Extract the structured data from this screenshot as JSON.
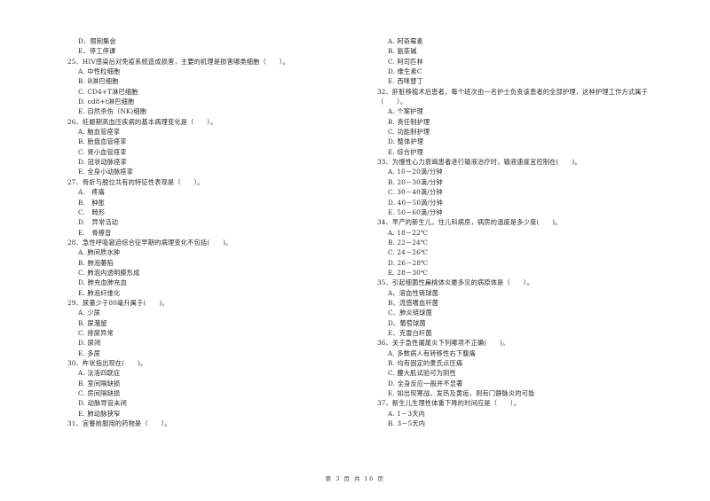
{
  "left_column": [
    {
      "type": "option",
      "text": "D、限制集会"
    },
    {
      "type": "option",
      "text": "E、停工停课"
    },
    {
      "type": "stem",
      "text": "25、HIV感染后对免疫系统造成损害，主要的机理是损害哪类细胞（　　）。"
    },
    {
      "type": "option",
      "text": "A. 中性粒细胞"
    },
    {
      "type": "option",
      "text": "B. B淋巴细胞"
    },
    {
      "type": "option",
      "text": "C. CD4+T淋巴细胞"
    },
    {
      "type": "option",
      "text": "D. cd8+t淋巴细胞"
    },
    {
      "type": "option",
      "text": "E. 自然杀伤（NK)细胞"
    },
    {
      "type": "stem",
      "text": "26、妊娠期高血压疾病的基本病理变化是（　　）。"
    },
    {
      "type": "option",
      "text": "A. 脑血管痉挛"
    },
    {
      "type": "option",
      "text": "B. 胎盘血管痉挛"
    },
    {
      "type": "option",
      "text": "C. 肾小血管痉挛"
    },
    {
      "type": "option",
      "text": "D. 冠状动脉痉挛"
    },
    {
      "type": "option",
      "text": "E. 全身小动脉痉挛"
    },
    {
      "type": "stem",
      "text": "27、骨折与脱位共有的特征性表现是（　　）。"
    },
    {
      "type": "option",
      "text": "A.　疼痛"
    },
    {
      "type": "option",
      "text": "B.　肿胀"
    },
    {
      "type": "option",
      "text": "C.　畸形"
    },
    {
      "type": "option",
      "text": "D.　异常活动"
    },
    {
      "type": "option",
      "text": "E.　骨擦音"
    },
    {
      "type": "stem",
      "text": "28、急性呼吸窘迫综合征早期的病理变化不包括(　　)。"
    },
    {
      "type": "option",
      "text": "A. 肺间质水肿"
    },
    {
      "type": "option",
      "text": "B. 肺泡萎陷"
    },
    {
      "type": "option",
      "text": "C. 肺泡内透明膜形成"
    },
    {
      "type": "option",
      "text": "D. 肺充血肺充血"
    },
    {
      "type": "option",
      "text": "E. 肺泡纤维化"
    },
    {
      "type": "stem",
      "text": "29、尿量少于80毫升属于(　　)。"
    },
    {
      "type": "option",
      "text": "A. 少尿"
    },
    {
      "type": "option",
      "text": "B. 尿潴留"
    },
    {
      "type": "option",
      "text": "C. 排尿异常"
    },
    {
      "type": "option",
      "text": "D. 尿闭"
    },
    {
      "type": "option",
      "text": "E. 多尿"
    },
    {
      "type": "stem",
      "text": "30、杵状指出现在(　　)。"
    },
    {
      "type": "option",
      "text": "A. 法洛四联症"
    },
    {
      "type": "option",
      "text": "B. 室间隔缺损"
    },
    {
      "type": "option",
      "text": "C. 房间隔缺损"
    },
    {
      "type": "option",
      "text": "D. 动脉导管未闭"
    },
    {
      "type": "option",
      "text": "E. 肺动脉狭窄"
    },
    {
      "type": "stem",
      "text": "31、宜餐前服用的药物是（　　）。"
    }
  ],
  "right_column": [
    {
      "type": "option",
      "text": "A. 阿奇霉素"
    },
    {
      "type": "option",
      "text": "B. 氨茶碱"
    },
    {
      "type": "option",
      "text": "C. 阿司匹林"
    },
    {
      "type": "option",
      "text": "D. 维生素C"
    },
    {
      "type": "option",
      "text": "E. 西咪替丁"
    },
    {
      "type": "stem",
      "text": "32、肝脏移植术后患者，每个班次由一名护士负责该患者的全部护理，这种护理工作方式属于"
    },
    {
      "type": "stem",
      "text": "（　　）。"
    },
    {
      "type": "option",
      "text": "A. 个案护理"
    },
    {
      "type": "option",
      "text": "B. 责任制护理"
    },
    {
      "type": "option",
      "text": "C. 功能制护理"
    },
    {
      "type": "option",
      "text": "D. 整体护理"
    },
    {
      "type": "option",
      "text": "E. 综合护理"
    },
    {
      "type": "stem",
      "text": "33、为慢性心力衰竭患者进行输液治疗时，输液速度宜控制在(　　)。"
    },
    {
      "type": "option",
      "text": "A. 10－20滴/分钟"
    },
    {
      "type": "option",
      "text": "B. 20－30滴/分钟"
    },
    {
      "type": "option",
      "text": "C. 30－40滴/分钟"
    },
    {
      "type": "option",
      "text": "D. 40－50滴/分钟"
    },
    {
      "type": "option",
      "text": "E. 50－60滴/分钟"
    },
    {
      "type": "stem",
      "text": "34、早产的新生儿，住儿科病房，病房的温度是多少度(　　)。"
    },
    {
      "type": "option",
      "text": "A. 18－22℃"
    },
    {
      "type": "option",
      "text": "B. 22－24℃"
    },
    {
      "type": "option",
      "text": "C. 24－26℃"
    },
    {
      "type": "option",
      "text": "D. 26－28℃"
    },
    {
      "type": "option",
      "text": "E. 28－30℃"
    },
    {
      "type": "stem",
      "text": "35、引起细菌性扁桃体炎最多见的病原体是（　　）。"
    },
    {
      "type": "option",
      "text": "A、溶血性链球菌"
    },
    {
      "type": "option",
      "text": "B、流感嗜血杆菌"
    },
    {
      "type": "option",
      "text": "C、肺炎链球菌"
    },
    {
      "type": "option",
      "text": "D、葡萄球菌"
    },
    {
      "type": "option",
      "text": "E、克雷白杆菌"
    },
    {
      "type": "stem",
      "text": "36、关于急性阑尾炎下列哪项不正确(　　)。"
    },
    {
      "type": "option",
      "text": "A. 多数病人有转移性右下腹痛"
    },
    {
      "type": "option",
      "text": "B. 均有固定的麦氏点压痛"
    },
    {
      "type": "option",
      "text": "C. 腰大肌试验可为阴性"
    },
    {
      "type": "option",
      "text": "D. 全身反应一般并不显著"
    },
    {
      "type": "option",
      "text": "E. 如出现寒战，发热及黄疸，则有门静脉炎的可能"
    },
    {
      "type": "stem",
      "text": "37、新生儿生理性体重下降的时间应是（　　）。"
    },
    {
      "type": "option",
      "text": "A. 1－3天内"
    },
    {
      "type": "option",
      "text": "B. 3－5天内"
    }
  ],
  "footer": {
    "page_label": "第 3 页 共 16 页"
  }
}
